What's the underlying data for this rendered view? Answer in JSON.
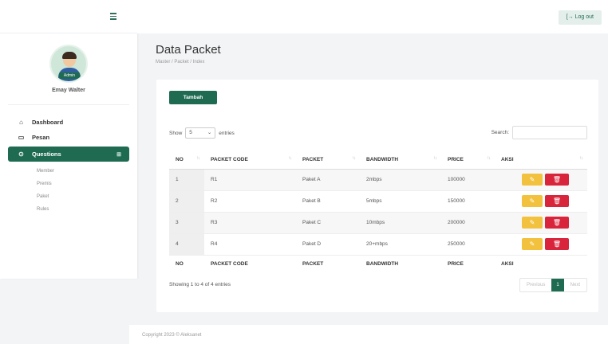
{
  "app": {
    "logout_label": "Log out",
    "logout_icon": "logout-icon",
    "copyright": "Copyright 2023 © Aleksanet"
  },
  "sidebar": {
    "user": {
      "name": "Emay Walter",
      "badge": "Admin"
    },
    "items": [
      {
        "label": "Dashboard",
        "icon": "home-icon"
      },
      {
        "label": "Pesan",
        "icon": "message-icon"
      },
      {
        "label": "Questions",
        "icon": "question-icon",
        "active": true
      }
    ],
    "submenu": [
      "Member",
      "Premis",
      "Paket",
      "Rules"
    ]
  },
  "page": {
    "title": "Data Packet",
    "breadcrumb": "Master / Packet / Index",
    "add_button": "Tambah"
  },
  "table_controls": {
    "show_label": "Show",
    "entries_value": "5",
    "entries_label": "entries",
    "search_label": "Search:"
  },
  "table": {
    "columns": [
      "NO",
      "PACKET CODE",
      "PACKET",
      "BANDWIDTH",
      "PRICE",
      "AKSI"
    ],
    "rows": [
      [
        "1",
        "R1",
        "Paket A",
        "2mbps",
        "100000"
      ],
      [
        "2",
        "R2",
        "Paket B",
        "5mbps",
        "150000"
      ],
      [
        "3",
        "R3",
        "Paket C",
        "10mbps",
        "200000"
      ],
      [
        "4",
        "R4",
        "Paket D",
        "20+mbps",
        "250000"
      ]
    ],
    "info": "Showing 1 to 4 of 4 entries",
    "pagination": {
      "previous": "Previous",
      "current": "1",
      "next": "Next"
    }
  },
  "colors": {
    "primary": "#1f6b52",
    "edit": "#f2c23e",
    "delete": "#d9253b"
  }
}
